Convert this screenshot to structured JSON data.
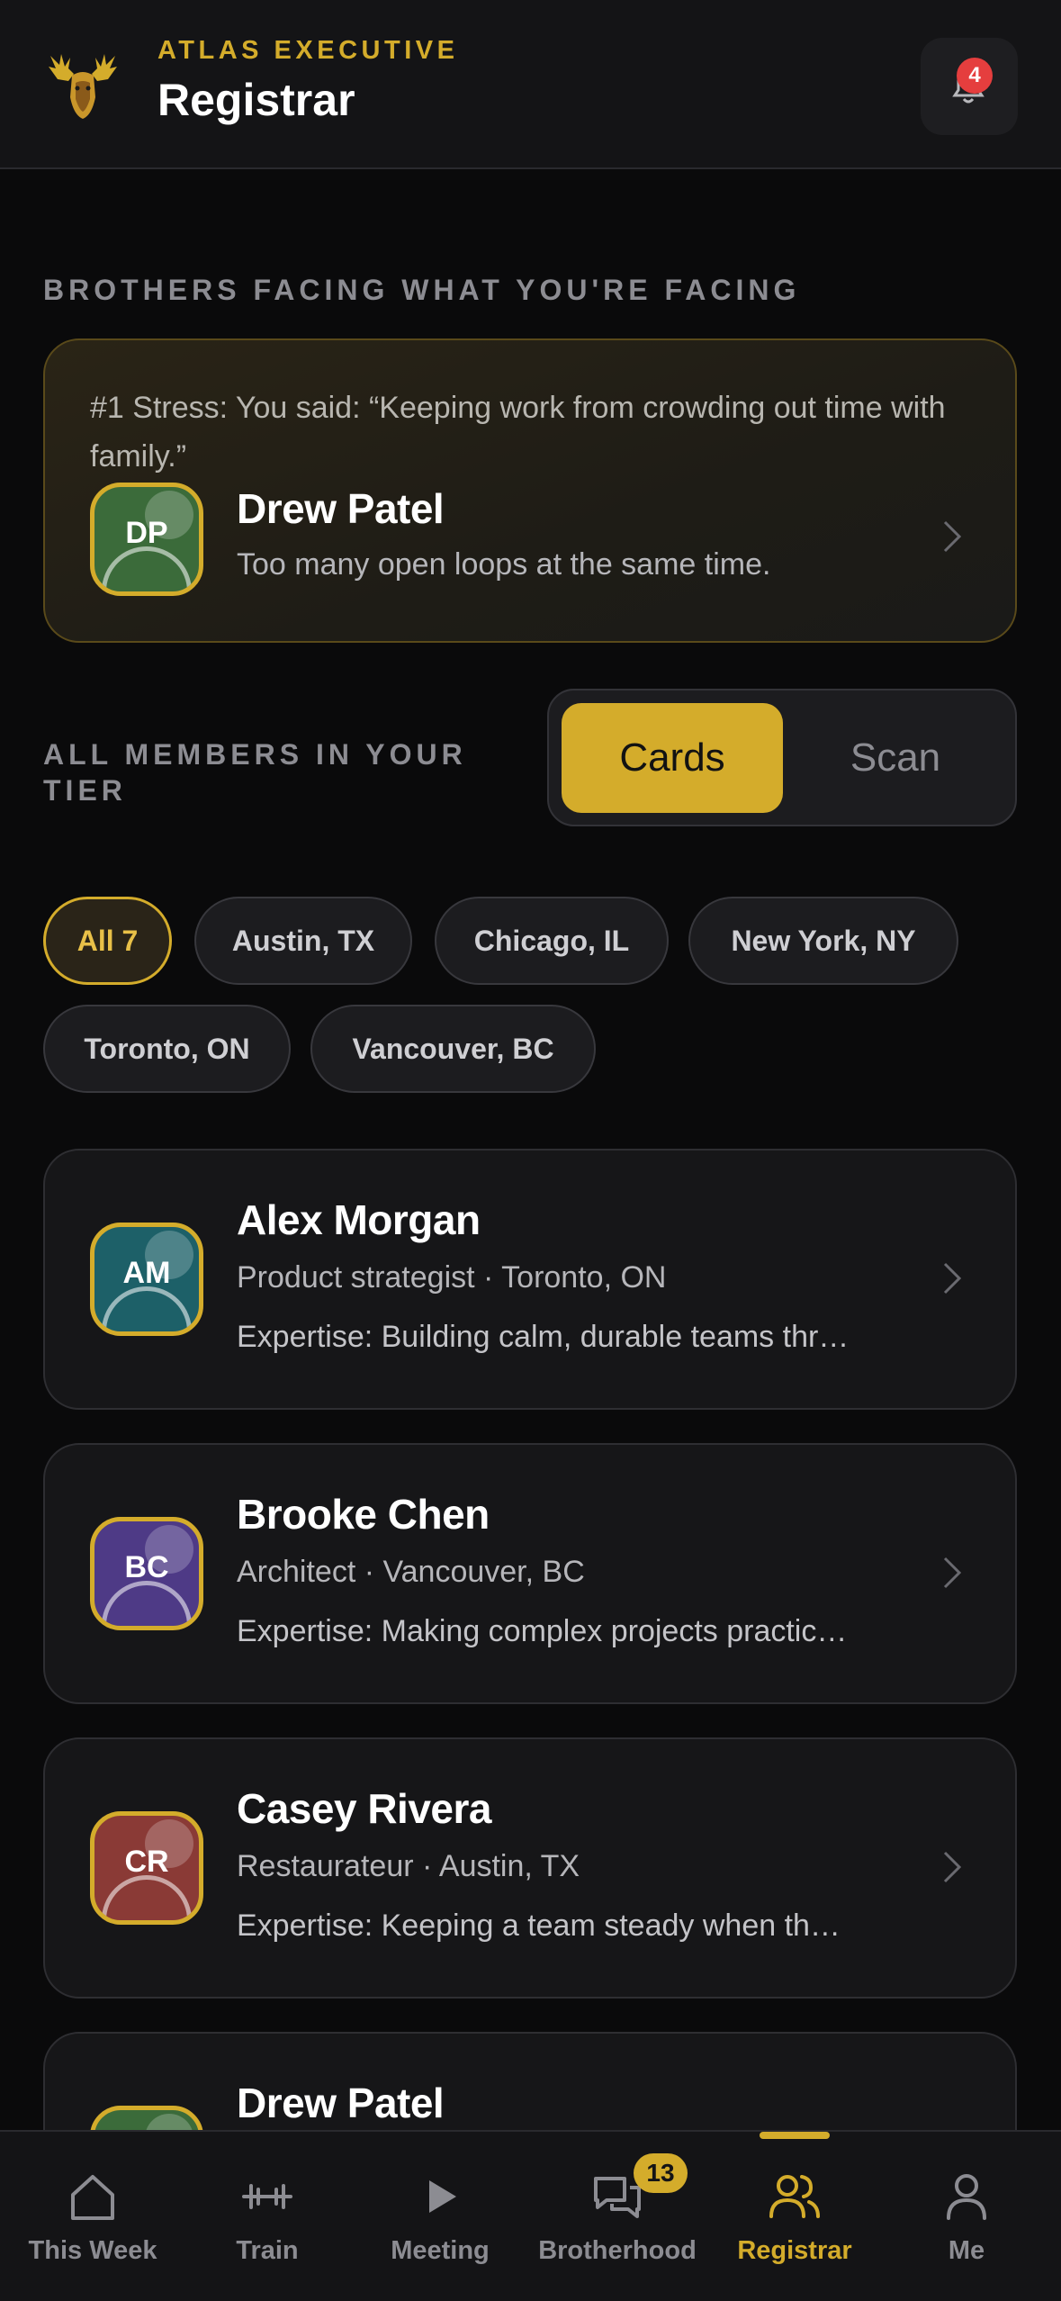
{
  "header": {
    "brand": "ATLAS EXECUTIVE",
    "title": "Registrar",
    "notifications_count": "4"
  },
  "facing": {
    "section_label": "BROTHERS FACING WHAT YOU'RE FACING",
    "quote": "#1 Stress: You said: “Keeping work from crowding out time with family.”",
    "member": {
      "initials": "DP",
      "name": "Drew Patel",
      "subtitle": "Too many open loops at the same time.",
      "color": "#3b6b3a"
    }
  },
  "members_section": {
    "label": "ALL MEMBERS IN YOUR TIER",
    "toggle": {
      "active": "Cards",
      "inactive": "Scan"
    }
  },
  "filters": [
    "All 7",
    "Austin, TX",
    "Chicago, IL",
    "New York, NY",
    "Toronto, ON",
    "Vancouver, BC"
  ],
  "members": [
    {
      "initials": "AM",
      "name": "Alex Morgan",
      "role_location": "Product strategist · Toronto, ON",
      "expertise": "Expertise: Building calm, durable teams thr…",
      "color": "#1d6068"
    },
    {
      "initials": "BC",
      "name": "Brooke Chen",
      "role_location": "Architect · Vancouver, BC",
      "expertise": "Expertise: Making complex projects practic…",
      "color": "#4e3a86"
    },
    {
      "initials": "CR",
      "name": "Casey Rivera",
      "role_location": "Restaurateur · Austin, TX",
      "expertise": "Expertise: Keeping a team steady when th…",
      "color": "#8a3a36"
    },
    {
      "initials": "DP",
      "name": "Drew Patel",
      "role_location": "",
      "expertise": "",
      "color": "#3b6b3a"
    }
  ],
  "nav": {
    "items": [
      {
        "label": "This Week",
        "icon": "home-icon"
      },
      {
        "label": "Train",
        "icon": "dumbbell-icon"
      },
      {
        "label": "Meeting",
        "icon": "play-icon"
      },
      {
        "label": "Brotherhood",
        "icon": "chat-icon",
        "badge": "13"
      },
      {
        "label": "Registrar",
        "icon": "users-icon",
        "active": true
      },
      {
        "label": "Me",
        "icon": "person-icon"
      }
    ]
  },
  "colors": {
    "accent": "#d4ac2b",
    "background": "#0a0a0b",
    "badge_red": "#e53e3e"
  }
}
